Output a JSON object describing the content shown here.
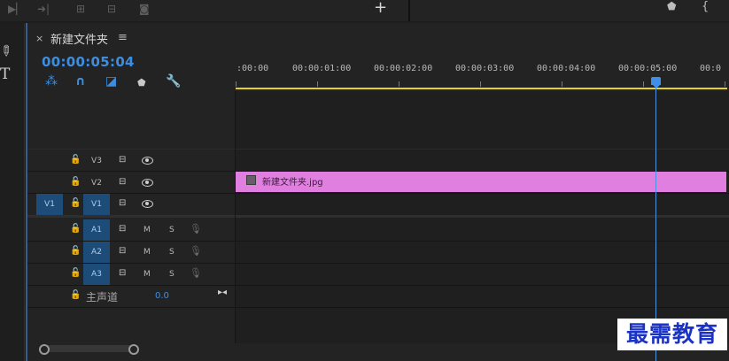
{
  "topbar": {
    "icons": [
      "play-to-out-icon",
      "insert-icon",
      "overwrite-icon",
      "export-frame-icon",
      "camera-icon"
    ],
    "add_label": "+",
    "marker_icon": "marker-icon",
    "brace_label": "{"
  },
  "tools": {
    "razor_icon": "razor-icon",
    "type_label": "T"
  },
  "sequence": {
    "close_label": "×",
    "name": "新建文件夹",
    "menu_label": "≡",
    "timecode": "00:00:05:04",
    "toolbar_icons": [
      "snap-icon",
      "linked-selection-icon",
      "add-marker-icon",
      "settings-wrench-icon"
    ]
  },
  "ruler": {
    "labels": [
      ":00:00",
      "00:00:01:00",
      "00:00:02:00",
      "00:00:03:00",
      "00:00:04:00",
      "00:00:05:00",
      "00:0"
    ]
  },
  "video_tracks": [
    {
      "name": "V3",
      "source": ""
    },
    {
      "name": "V2",
      "source": ""
    },
    {
      "name": "V1",
      "source": "V1"
    }
  ],
  "audio_tracks": [
    {
      "name": "A1",
      "mute": "M",
      "solo": "S"
    },
    {
      "name": "A2",
      "mute": "M",
      "solo": "S"
    },
    {
      "name": "A3",
      "mute": "M",
      "solo": "S"
    }
  ],
  "master": {
    "label": "主声道",
    "value": "0.0"
  },
  "clip": {
    "name": "新建文件夹.jpg",
    "track": "V2",
    "color": "#e17fe1"
  },
  "playhead": {
    "timecode": "00:00:05:04"
  },
  "watermark": {
    "text": "最需教育"
  }
}
